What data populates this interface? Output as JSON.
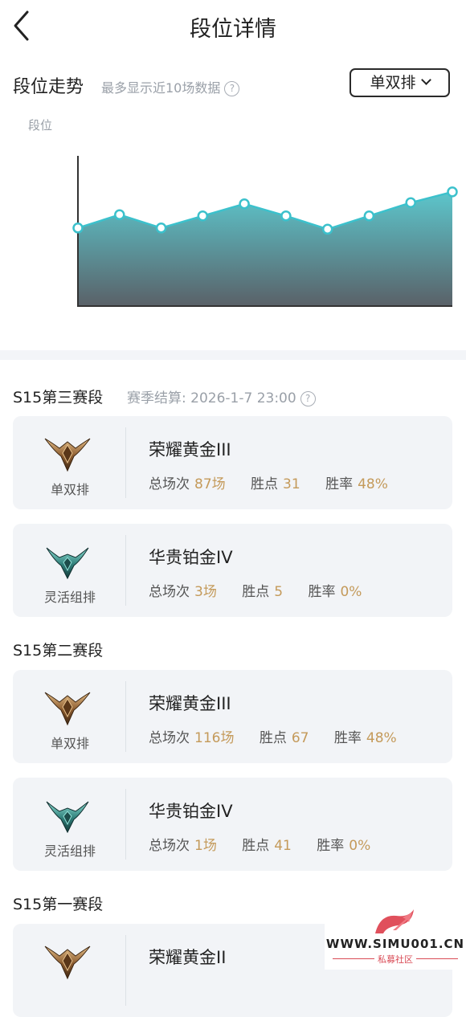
{
  "header": {
    "title": "段位详情"
  },
  "trend": {
    "title": "段位走势",
    "note": "最多显示近10场数据",
    "mode_label": "单双排",
    "y_label": "段位"
  },
  "chart_data": {
    "type": "area",
    "ylabel": "段位",
    "x": [
      1,
      2,
      3,
      4,
      5,
      6,
      7,
      8,
      9,
      10
    ],
    "values": [
      3.0,
      4.1,
      3.0,
      4.0,
      5.0,
      4.0,
      2.9,
      4.0,
      5.1,
      6.0
    ],
    "ylim": [
      -3.5,
      9.0
    ],
    "grid": false,
    "colors": {
      "line": "#3cc1cc",
      "fill_top": "#5cc6cc",
      "fill_bottom": "#5a6168"
    }
  },
  "seasons": [
    {
      "title": "S15第三赛段",
      "settle": "赛季结算: 2026-1-7 23:00",
      "cards": [
        {
          "mode": "单双排",
          "rank": "荣耀黄金III",
          "total_label": "总场次",
          "total": "87场",
          "points_label": "胜点",
          "points": "31",
          "rate_label": "胜率",
          "rate": "48%",
          "badge": "gold-rank-icon"
        },
        {
          "mode": "灵活组排",
          "rank": "华贵铂金IV",
          "total_label": "总场次",
          "total": "3场",
          "points_label": "胜点",
          "points": "5",
          "rate_label": "胜率",
          "rate": "0%",
          "badge": "platinum-rank-icon"
        }
      ]
    },
    {
      "title": "S15第二赛段",
      "cards": [
        {
          "mode": "单双排",
          "rank": "荣耀黄金III",
          "total_label": "总场次",
          "total": "116场",
          "points_label": "胜点",
          "points": "67",
          "rate_label": "胜率",
          "rate": "48%",
          "badge": "gold-rank-icon"
        },
        {
          "mode": "灵活组排",
          "rank": "华贵铂金IV",
          "total_label": "总场次",
          "total": "1场",
          "points_label": "胜点",
          "points": "41",
          "rate_label": "胜率",
          "rate": "0%",
          "badge": "platinum-rank-icon"
        }
      ]
    },
    {
      "title": "S15第一赛段",
      "cards": [
        {
          "rank": "荣耀黄金II",
          "badge": "gold-rank-icon"
        }
      ]
    }
  ],
  "watermark": {
    "text": "WWW.SIMU001.CN",
    "sub": "私募社区"
  },
  "colors": {
    "accent_value": "#c49a5a",
    "card_bg": "#f2f4f7",
    "muted_text": "#9aa0a8"
  }
}
